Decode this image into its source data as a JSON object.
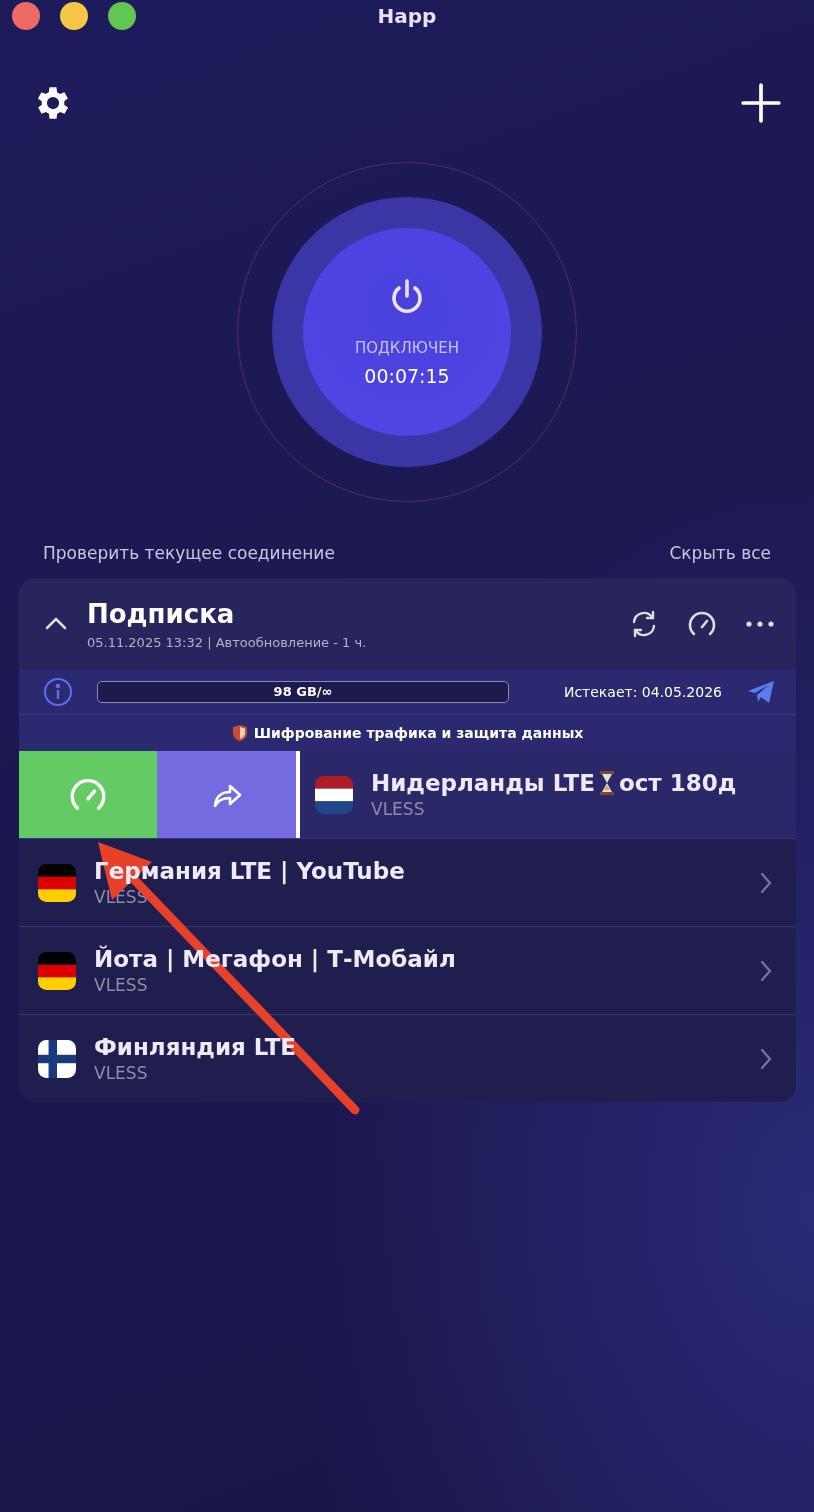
{
  "window": {
    "title": "Happ"
  },
  "connection": {
    "status": "ПОДКЛЮЧЕН",
    "timer": "00:07:15",
    "connected": true
  },
  "links": {
    "check": "Проверить текущее соединение",
    "hide": "Скрыть все"
  },
  "subscription": {
    "title": "Подписка",
    "expanded": true,
    "updated": "05.11.2025 13:32 | Автообновление - 1 ч.",
    "traffic": "98 GB/∞",
    "expires": "Истекает: 04.05.2026",
    "notice": "Шифрование трафика и защита данных"
  },
  "servers": [
    {
      "kind": "netherlands",
      "name": "Нидерланды LTE",
      "note": "ост 180д",
      "protocol": "VLESS",
      "swiped": true
    },
    {
      "kind": "germany",
      "name": "Германия LTE | YouTube",
      "protocol": "VLESS",
      "swiped": false
    },
    {
      "kind": "germany",
      "name": "Йота | Мегафон | Т-Мобайл",
      "protocol": "VLESS",
      "swiped": false
    },
    {
      "kind": "finland",
      "name": "Финляндия LTE",
      "protocol": "VLESS",
      "swiped": false
    }
  ]
}
